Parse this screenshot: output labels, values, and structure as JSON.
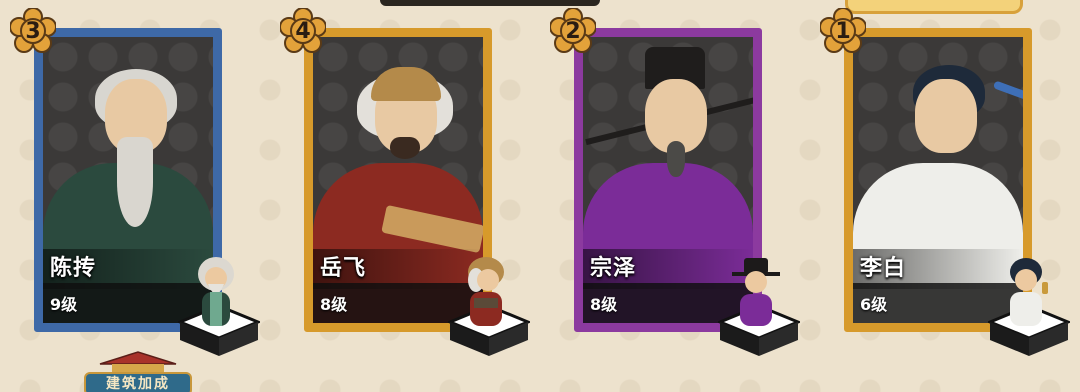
{
  "heroes": [
    {
      "rank": "3",
      "name": "陈抟",
      "level": "9级",
      "frame": "blue",
      "robe": "#2b4a3e",
      "accent": "#6fa98f"
    },
    {
      "rank": "4",
      "name": "岳飞",
      "level": "8级",
      "frame": "gold",
      "robe": "#8c2a21",
      "accent": "#c99a5b"
    },
    {
      "rank": "2",
      "name": "宗泽",
      "level": "8级",
      "frame": "purple",
      "robe": "#7b2c98",
      "accent": "#1c1a1a"
    },
    {
      "rank": "1",
      "name": "李白",
      "level": "6级",
      "frame": "gold",
      "robe": "#eeeeea",
      "accent": "#1e2a3a"
    }
  ],
  "building_bonus": {
    "label": "建筑加成"
  },
  "colors": {
    "background": "#ede2cd",
    "frame_blue": "#3e69a7",
    "frame_gold": "#d79a2b",
    "frame_purple": "#8c3a9f",
    "badge": "#e3a23a"
  }
}
